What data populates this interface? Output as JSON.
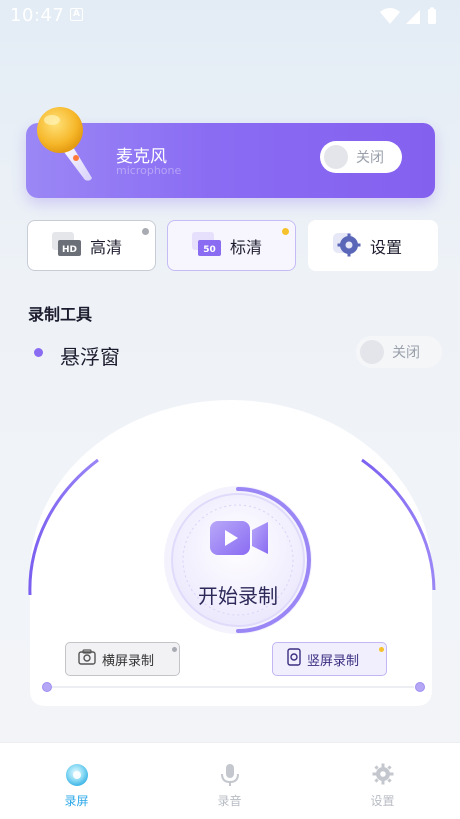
{
  "status_bar": {
    "time": "10:47",
    "notification_letter": "A"
  },
  "mic_card": {
    "title": "麦克风",
    "subtitle": "microphone",
    "toggle_label": "关闭"
  },
  "quality": {
    "hd_badge": "HD",
    "hd_label": "高清",
    "sd_badge": "50",
    "sd_label": "标清",
    "settings_label": "设置"
  },
  "section_title": "录制工具",
  "floating_window": {
    "label": "悬浮窗",
    "toggle_label": "关闭"
  },
  "recorder": {
    "start_label": "开始录制",
    "landscape_label": "横屏录制",
    "portrait_label": "竖屏录制"
  },
  "bottom_nav": [
    {
      "label": "录屏",
      "active": true
    },
    {
      "label": "录音",
      "active": false
    },
    {
      "label": "设置",
      "active": false
    }
  ],
  "colors": {
    "accent": "#8a6cf3",
    "active_nav": "#2aa7e8",
    "inactive_nav": "#b8bcc4",
    "dot_grey": "#a8abb2",
    "dot_yellow": "#f6c22b"
  }
}
